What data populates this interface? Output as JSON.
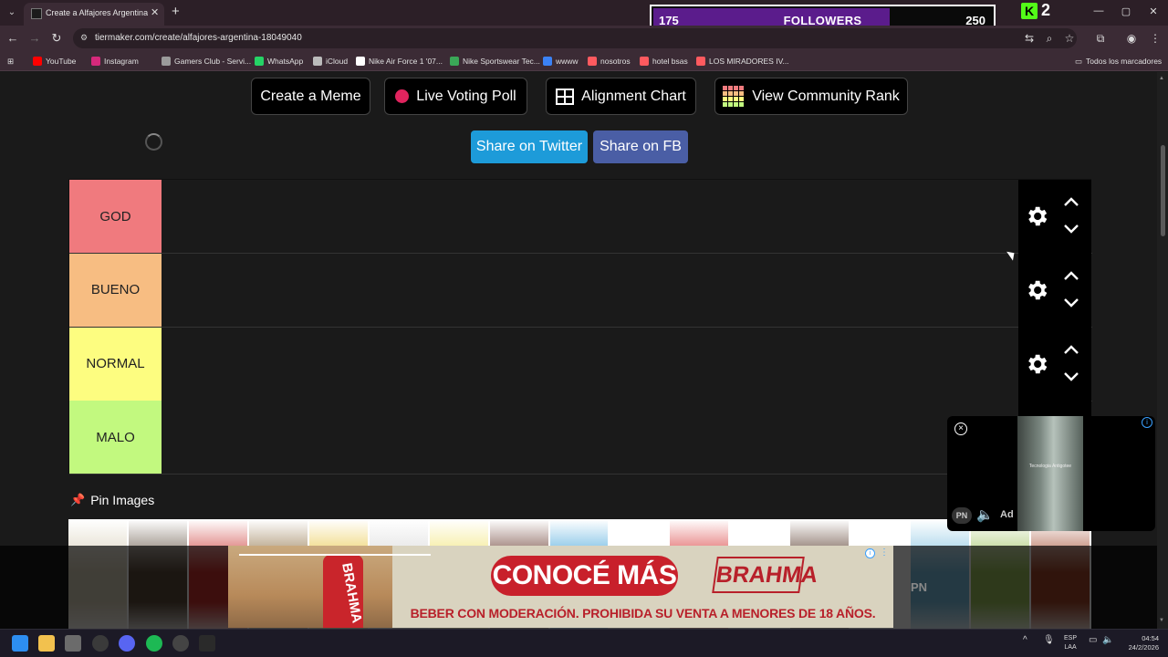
{
  "browser": {
    "tab_title": "Create a Alfajores Argentina Tier",
    "tab_close": "✕",
    "new_tab": "+",
    "url": "tiermaker.com/create/alfajores-argentina-18049040",
    "window_controls": {
      "minimize": "—",
      "maximize": "▢",
      "close": "✕"
    },
    "bookmarks": [
      {
        "label": "YouTube",
        "icon": "youtube-icon",
        "color": "#ff0000"
      },
      {
        "label": "Instagram",
        "icon": "instagram-icon",
        "color": "#d6297b"
      },
      {
        "label": "Gamers Club - Servi...",
        "icon": "gamersclub-icon",
        "color": "#9b9b9b"
      },
      {
        "label": "WhatsApp",
        "icon": "whatsapp-icon",
        "color": "#25d366"
      },
      {
        "label": "iCloud",
        "icon": "apple-icon",
        "color": "#bbbbbb"
      },
      {
        "label": "Nike Air Force 1 '07...",
        "icon": "nike-icon",
        "color": "#ffffff"
      },
      {
        "label": "Nike Sportswear Tec...",
        "icon": "nike-icon",
        "color": "#3aa757"
      },
      {
        "label": "wwww",
        "icon": "globe-icon",
        "color": "#3b82f6"
      },
      {
        "label": "nosotros",
        "icon": "airbnb-icon",
        "color": "#ff5a5f"
      },
      {
        "label": "hotel bsas",
        "icon": "airbnb-icon",
        "color": "#ff5a5f"
      },
      {
        "label": "LOS MIRADORES IV...",
        "icon": "airbnb-icon",
        "color": "#ff5a5f"
      }
    ],
    "all_bookmarks_label": "Todos los marcadores"
  },
  "stream_overlay": {
    "followers_current": "175",
    "followers_label": "FOLLOWERS",
    "followers_goal": "250",
    "followers_progress": 0.7,
    "kick_letter": "K",
    "kick_count": "2",
    "accent_color": "#5b1c8c"
  },
  "actions": {
    "create_meme": "Create a Meme",
    "live_voting_poll": "Live Voting Poll",
    "alignment_chart": "Alignment Chart",
    "view_community_rank": "View Community Rank",
    "share_twitter": "Share on Twitter",
    "share_fb": "Share on FB"
  },
  "tiers": [
    {
      "label": "GOD",
      "color": "#f07a7e"
    },
    {
      "label": "BUENO",
      "color": "#f7bd82"
    },
    {
      "label": "NORMAL",
      "color": "#fdfd80"
    },
    {
      "label": "MALO",
      "color": "#c2f97f"
    }
  ],
  "pin_images": {
    "heading": "Pin Images",
    "thumbs": [
      {
        "color": "#d8cfb8"
      },
      {
        "color": "#5b4a3a"
      },
      {
        "color": "#c9302c"
      },
      {
        "color": "#8a6a3c"
      },
      {
        "color": "#e8c33a"
      },
      {
        "color": "#d8d8d8"
      },
      {
        "color": "#f1e26a"
      },
      {
        "color": "#5c2a1e"
      },
      {
        "color": "#3aa0d8"
      },
      {
        "color": "#ffffff"
      },
      {
        "color": "#d62d2d"
      },
      {
        "color": "#ffffff"
      },
      {
        "color": "#4a2a1a"
      },
      {
        "color": "#ffffff"
      },
      {
        "color": "#7bbfe0"
      },
      {
        "color": "#9ac05a"
      },
      {
        "color": "#a0452a"
      }
    ]
  },
  "video_ad": {
    "caption": "Tecnologia Antigotee",
    "badge": "PN",
    "label": "Ad"
  },
  "banner_ad": {
    "cta": "CONOCÉ MÁS",
    "brand": "BRAHMA",
    "can_text": "BRAHMA",
    "disclaimer": "BEBER CON MODERACIÓN. PROHIBIDA SU VENTA A MENORES DE 18 AÑOS.",
    "side_badge": "PN"
  },
  "taskbar": {
    "lang_line1": "ESP",
    "lang_line2": "LAA",
    "time": "04:54",
    "date": "24/2/2026"
  }
}
